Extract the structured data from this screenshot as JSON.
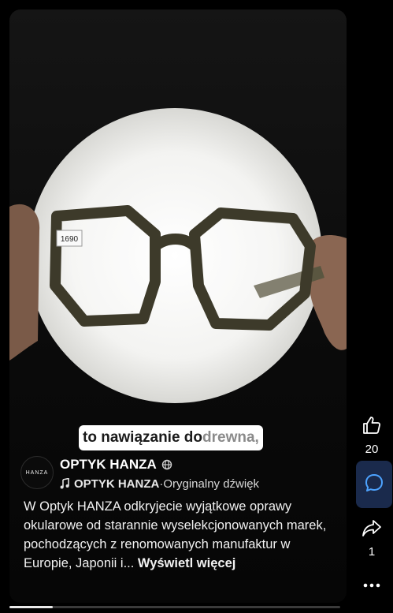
{
  "video": {
    "caption_main": "to nawiązanie do ",
    "caption_highlight": "drewna,",
    "price_tag": "1690",
    "progress": 0.13
  },
  "author": {
    "avatar_text": "HANZA",
    "name": "OPTYK HANZA",
    "audio_author": "OPTYK HANZA",
    "audio_sep": " · ",
    "audio_label": "Oryginalny dźwięk"
  },
  "description": {
    "text": "W Optyk HANZA odkryjecie wyjątkowe oprawy okularowe od starannie wyselekcjonowanych marek, pochodzących z renomowanych manufaktur w Europie, Japonii i... ",
    "more": "Wyświetl więcej"
  },
  "actions": {
    "likes": "20",
    "shares": "1"
  },
  "icons": {
    "like": "thumbs-up-icon",
    "comment": "comment-icon",
    "share": "share-icon",
    "more": "more-icon",
    "globe": "globe-icon",
    "music": "music-note-icon"
  },
  "colors": {
    "background": "#000000",
    "comment_active": "#1a2a4c",
    "caption_highlight": "#8a8a8a"
  }
}
